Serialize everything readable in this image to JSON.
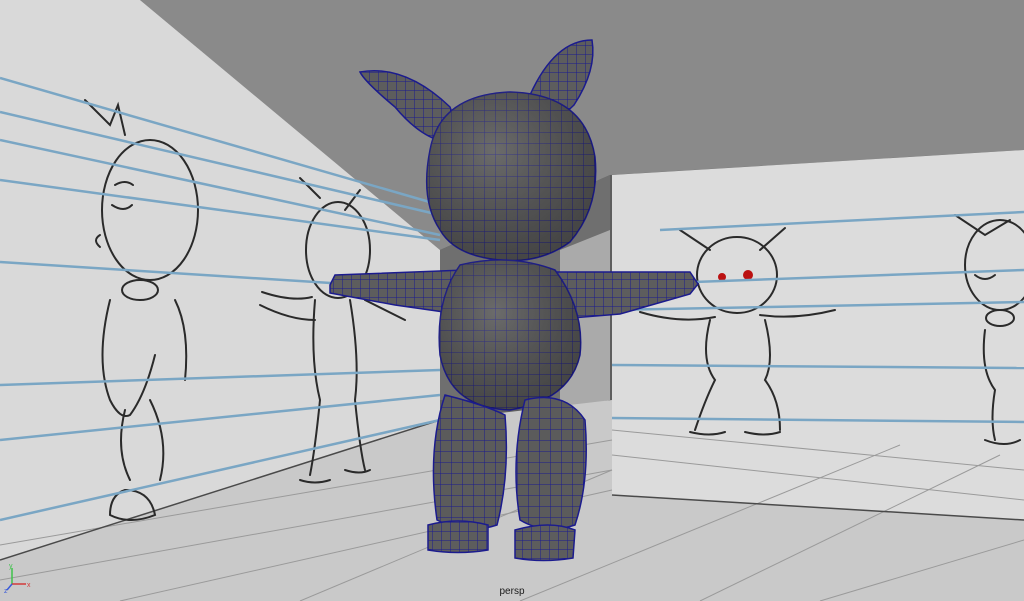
{
  "viewport": {
    "camera_label": "persp",
    "background_color": "#5f5f5f",
    "wall_color": "#d9d9d9",
    "floor_color": "#cdcdcd",
    "mesh_color": "#5a5a5a",
    "wire_color": "#1a1a8c",
    "guide_line_color": "#7aa6c2"
  },
  "axis_gizmo": {
    "x_label": "x",
    "y_label": "y",
    "z_label": "z",
    "x_color": "#d33b3b",
    "y_color": "#3ec24a",
    "z_color": "#3a5bd8"
  },
  "scene": {
    "model": "bunny-character-mesh",
    "reference_images": [
      "side-view-sketch-left",
      "front-view-sketch-left",
      "front-view-sketch-right",
      "side-view-sketch-right"
    ]
  }
}
